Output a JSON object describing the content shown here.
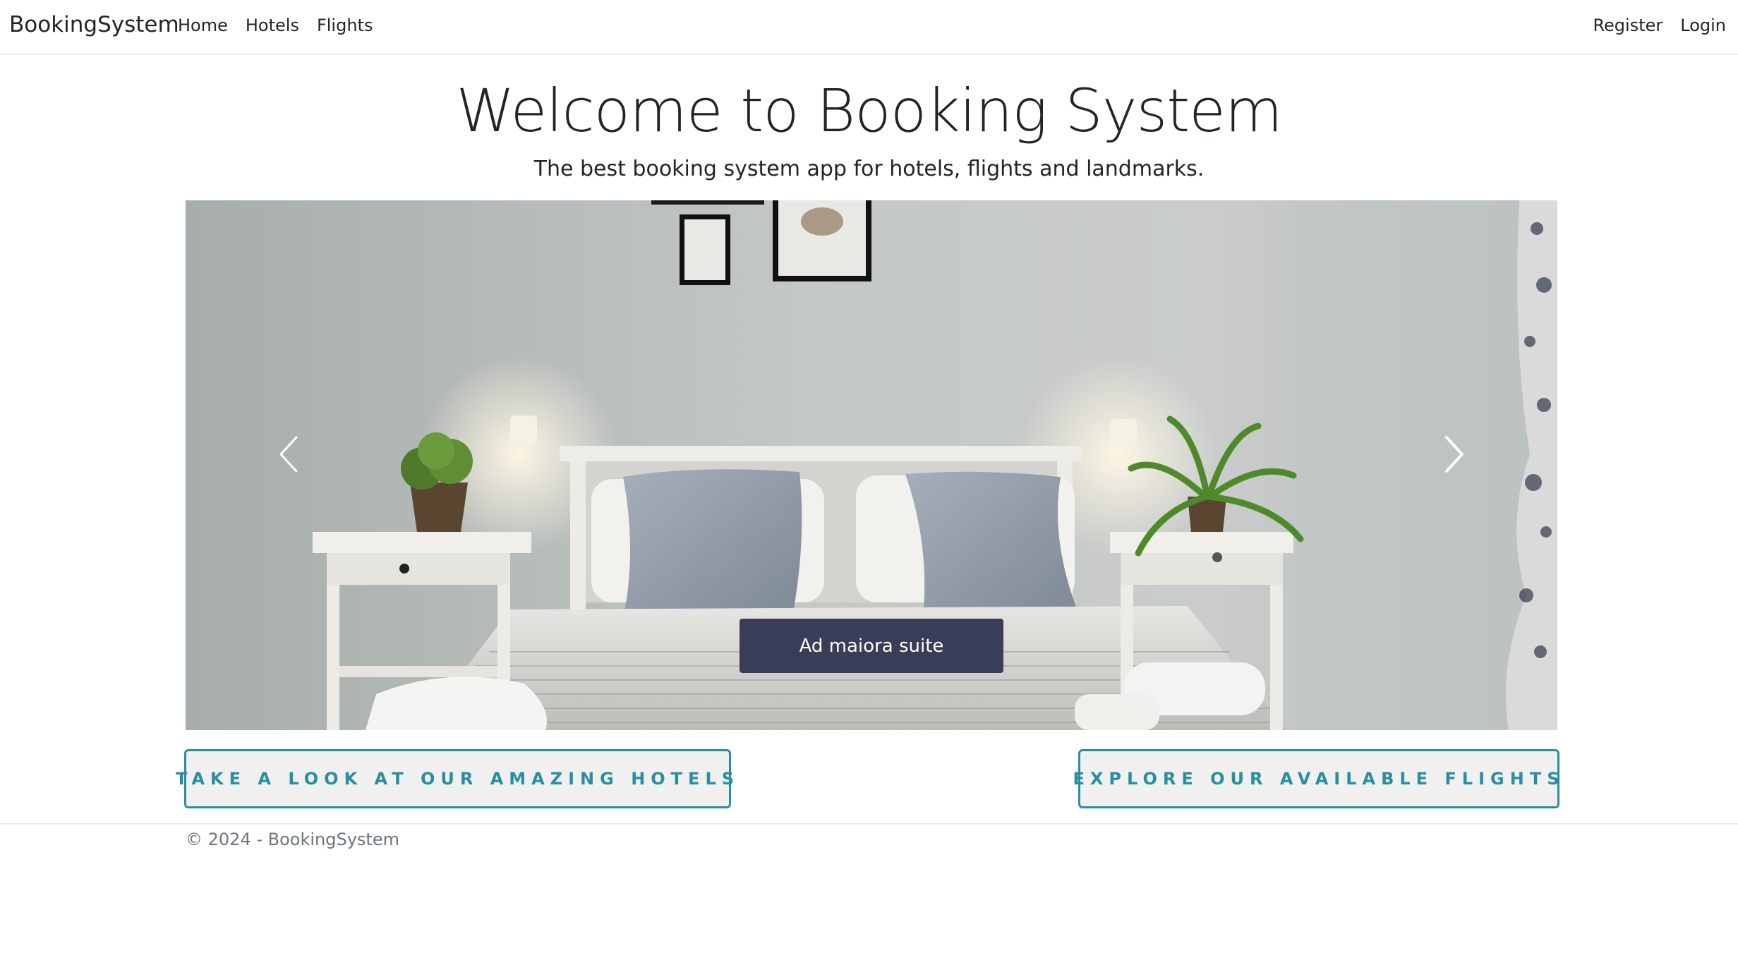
{
  "navbar": {
    "brand": "BookingSystem",
    "left_links": [
      "Home",
      "Hotels",
      "Flights"
    ],
    "right_links": [
      "Register",
      "Login"
    ]
  },
  "hero": {
    "title": "Welcome to Booking System",
    "subtitle": "The best booking system app for hotels, flights and landmarks."
  },
  "carousel": {
    "caption": "Ad maiora suite",
    "prev_icon": "chevron-left-icon",
    "next_icon": "chevron-right-icon"
  },
  "actions": {
    "hotels_label": "TAKE A LOOK AT OUR AMAZING HOTELS",
    "flights_label": "EXPLORE OUR AVAILABLE FLIGHTS"
  },
  "footer": {
    "text": "© 2024 - BookingSystem"
  },
  "colors": {
    "accent": "#2a8ea0",
    "caption_bg": "#3a3d58",
    "button_bg": "#f0f0f0",
    "footer_text": "#6c757d"
  }
}
